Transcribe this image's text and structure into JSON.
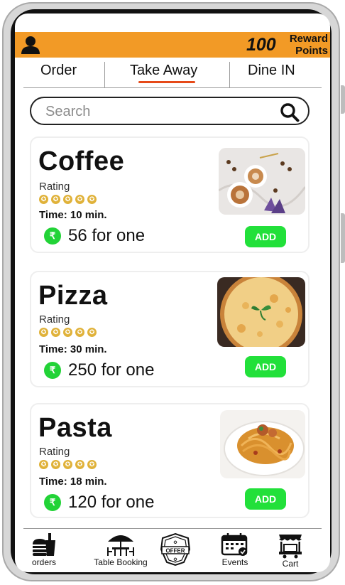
{
  "header": {
    "avatar_icon": "user-icon",
    "points_value": "100",
    "points_label": "Reward Points",
    "accent_color": "#f29a26"
  },
  "tabs": [
    {
      "label": "Order",
      "active": false
    },
    {
      "label": "Take Away",
      "active": true
    },
    {
      "label": "Dine IN",
      "active": false
    }
  ],
  "search": {
    "placeholder": "Search",
    "icon": "search-icon"
  },
  "items": [
    {
      "name": "Coffee",
      "rating_label": "Rating",
      "stars": 5,
      "time": "Time: 10 min.",
      "price": "56 for one",
      "add_label": "ADD",
      "image": "coffee-photo"
    },
    {
      "name": "Pizza",
      "rating_label": "Rating",
      "stars": 5,
      "time": "Time: 30 min.",
      "price": "250 for one",
      "add_label": "ADD",
      "image": "pizza-photo"
    },
    {
      "name": "Pasta",
      "rating_label": "Rating",
      "stars": 5,
      "time": "Time: 18 min.",
      "price": "120 for one",
      "add_label": "ADD",
      "image": "pasta-photo"
    }
  ],
  "currency_symbol": "₹",
  "bottom_nav": [
    {
      "label": "orders",
      "icon": "orders-icon"
    },
    {
      "label": "Table Booking",
      "icon": "table-booking-icon"
    },
    {
      "label": "",
      "icon": "offer-badge-icon",
      "badge_text": "OFFER"
    },
    {
      "label": "Events",
      "icon": "calendar-icon"
    },
    {
      "label": "Cart",
      "icon": "cart-icon"
    }
  ],
  "colors": {
    "add_button": "#22e03a",
    "rupee_badge": "#22d337",
    "tab_underline": "#e64a19",
    "star": "#e0b23a"
  }
}
